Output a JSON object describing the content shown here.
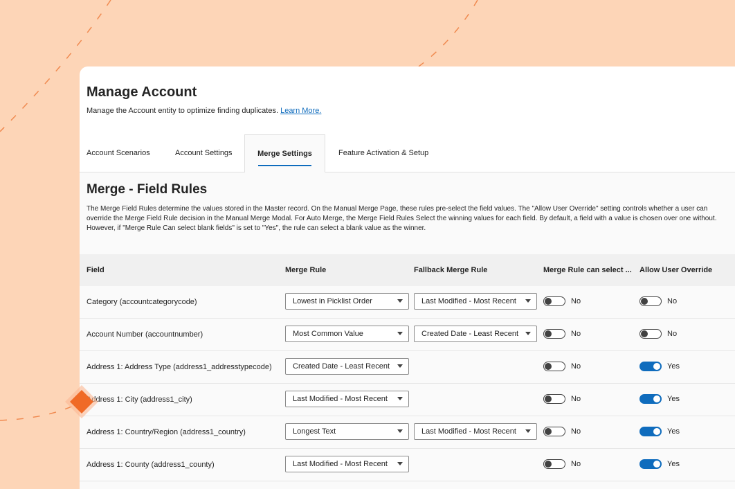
{
  "header": {
    "title": "Manage Account",
    "subtitle": "Manage the Account entity to optimize finding duplicates.",
    "learn_more": "Learn More."
  },
  "tabs": [
    {
      "label": "Account Scenarios",
      "active": false
    },
    {
      "label": "Account Settings",
      "active": false
    },
    {
      "label": "Merge Settings",
      "active": true
    },
    {
      "label": "Feature Activation & Setup",
      "active": false
    }
  ],
  "section": {
    "title": "Merge - Field Rules",
    "description": "The Merge Field Rules determine the values stored in the Master record. On the Manual Merge Page, these rules pre-select the field values. The \"Allow User Override\" setting controls whether a user can override the Merge Field Rule decision in the Manual Merge Modal. For Auto Merge, the Merge Field Rules Select the winning values for each field. By default, a field with a value is chosen over one without. However, if \"Merge Rule Can select blank fields\" is set to \"Yes\", the rule can select a blank value as the winner."
  },
  "table": {
    "columns": [
      "Field",
      "Merge Rule",
      "Fallback Merge Rule",
      "Merge Rule can select ...",
      "Allow User Override"
    ],
    "rows": [
      {
        "field": "Category (accountcategorycode)",
        "merge_rule": "Lowest in Picklist Order",
        "fallback": "Last Modified - Most Recent",
        "blank_label": "No",
        "blank_on": false,
        "override_label": "No",
        "override_on": false
      },
      {
        "field": "Account Number (accountnumber)",
        "merge_rule": "Most Common Value",
        "fallback": "Created Date - Least Recent",
        "blank_label": "No",
        "blank_on": false,
        "override_label": "No",
        "override_on": false
      },
      {
        "field": "Address 1: Address Type (address1_addresstypecode)",
        "merge_rule": "Created Date - Least Recent",
        "fallback": null,
        "blank_label": "No",
        "blank_on": false,
        "override_label": "Yes",
        "override_on": true
      },
      {
        "field": "Address 1: City (address1_city)",
        "merge_rule": "Last Modified - Most Recent",
        "fallback": null,
        "blank_label": "No",
        "blank_on": false,
        "override_label": "Yes",
        "override_on": true
      },
      {
        "field": "Address 1: Country/Region (address1_country)",
        "merge_rule": "Longest Text",
        "fallback": "Last Modified - Most Recent",
        "blank_label": "No",
        "blank_on": false,
        "override_label": "Yes",
        "override_on": true
      },
      {
        "field": "Address 1: County (address1_county)",
        "merge_rule": "Last Modified - Most Recent",
        "fallback": null,
        "blank_label": "No",
        "blank_on": false,
        "override_label": "Yes",
        "override_on": true
      }
    ]
  },
  "colors": {
    "background": "#fdd5b7",
    "accent": "#0f6cbd",
    "diamond": "#f06a26"
  }
}
